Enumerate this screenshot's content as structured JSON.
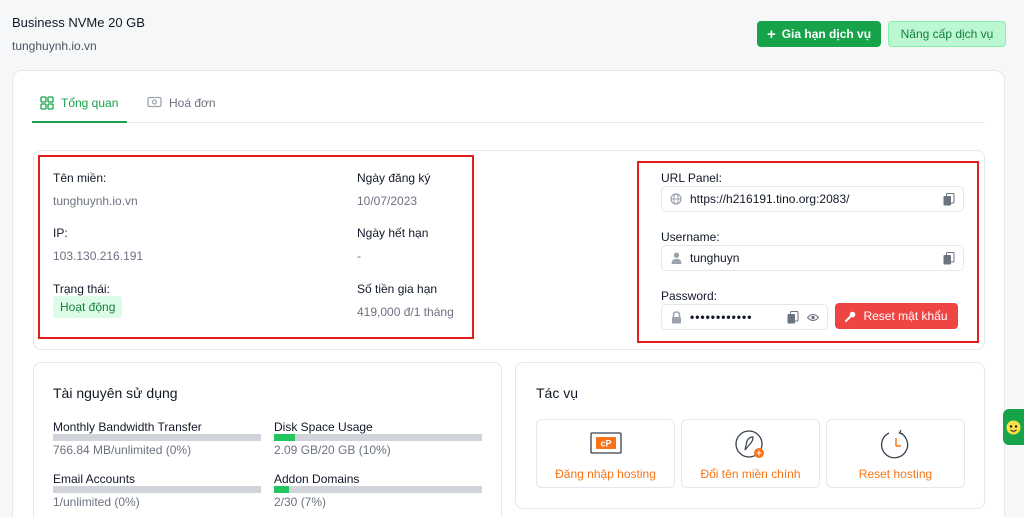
{
  "header": {
    "title": "Business NVMe 20 GB",
    "domain": "tunghuynh.io.vn",
    "renew_label": "Gia hạn dịch vụ",
    "upgrade_label": "Nâng cấp dịch vụ"
  },
  "tabs": [
    {
      "label": "Tổng quan",
      "icon": "grid-icon"
    },
    {
      "label": "Hoá đơn",
      "icon": "invoice-icon"
    }
  ],
  "info": {
    "domain_label": "Tên miền:",
    "domain_value": "tunghuynh.io.vn",
    "ip_label": "IP:",
    "ip_value": "103.130.216.191",
    "status_label": "Trạng thái:",
    "status_value": "Hoạt động",
    "reg_date_label": "Ngày đăng ký",
    "reg_date_value": "10/07/2023",
    "exp_date_label": "Ngày hết hạn",
    "exp_date_value": "-",
    "renew_price_label": "Số tiền gia hạn",
    "renew_price_value": "419,000 đ/1 tháng"
  },
  "panel": {
    "url_label": "URL Panel:",
    "url_value": "https://h216191.tino.org:2083/",
    "username_label": "Username:",
    "username_value": "tunghuyn",
    "password_label": "Password:",
    "password_value": "••••••••••••",
    "reset_password_label": "Reset mật khẩu"
  },
  "resources": {
    "title": "Tài nguyên sử dụng",
    "items": [
      {
        "label": "Monthly Bandwidth Transfer",
        "value": "766.84 MB/unlimited (0%)",
        "fraction": 0.0
      },
      {
        "label": "Disk Space Usage",
        "value": "2.09 GB/20 GB (10%)",
        "fraction": 0.1
      },
      {
        "label": "Email Accounts",
        "value": "1/unlimited (0%)",
        "fraction": 0.0
      },
      {
        "label": "Addon Domains",
        "value": "2/30 (7%)",
        "fraction": 0.07
      }
    ]
  },
  "tasks": {
    "title": "Tác vụ",
    "items": [
      {
        "label": "Đăng nhập hosting",
        "icon": "cpanel-icon"
      },
      {
        "label": "Đổi tên miền chính",
        "icon": "rocket-icon"
      },
      {
        "label": "Reset hosting",
        "icon": "clock-reset-icon"
      }
    ]
  },
  "colors": {
    "brand_green": "#16a34a",
    "danger_red": "#ef4444",
    "task_orange": "#f97316",
    "highlight_red": "#e11d1d"
  }
}
